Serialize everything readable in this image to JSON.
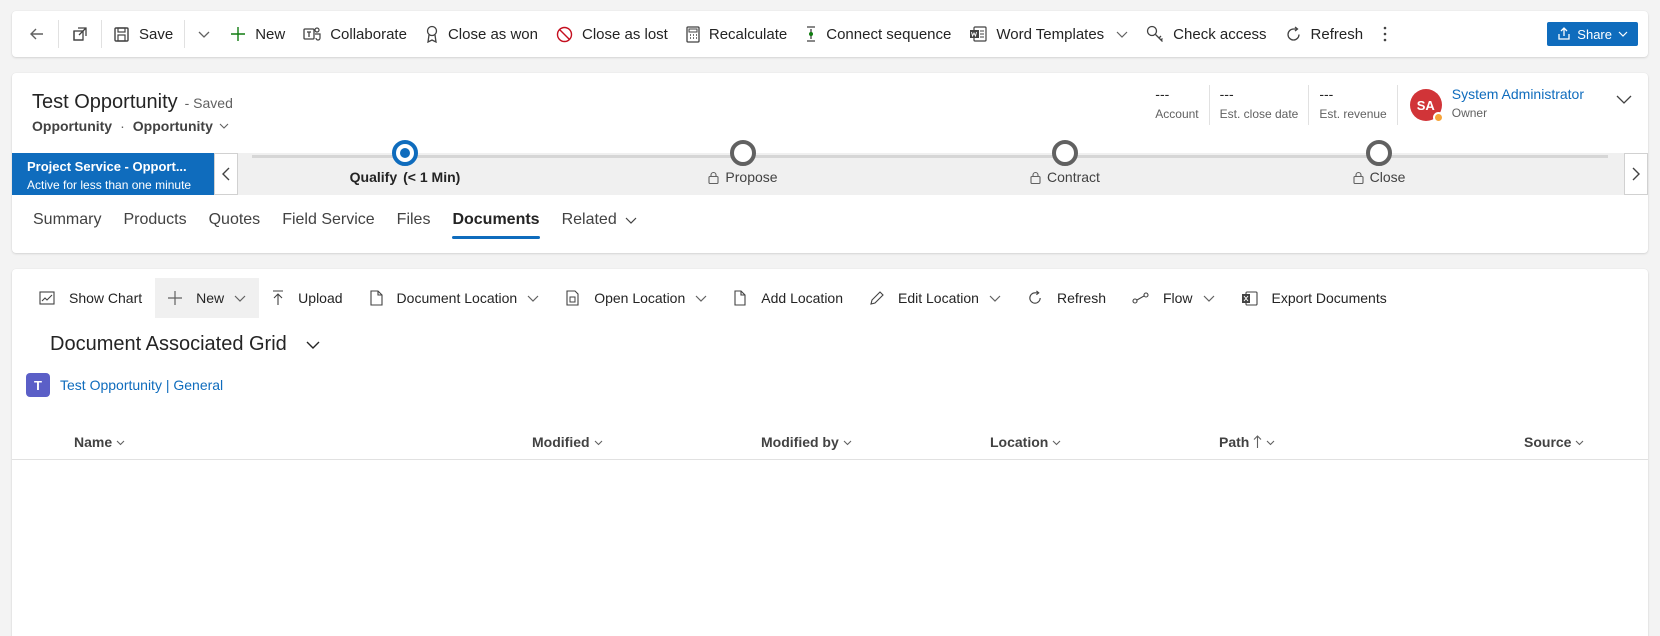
{
  "command_bar": {
    "back": {
      "icon": "back-arrow-icon"
    },
    "popout": {
      "icon": "open-new-window-icon"
    },
    "items": [
      {
        "key": "save",
        "label": "Save",
        "icon": "save-icon"
      },
      {
        "key": "new",
        "label": "New",
        "icon": "plus-icon"
      },
      {
        "key": "collaborate",
        "label": "Collaborate",
        "icon": "teams-icon"
      },
      {
        "key": "close_won",
        "label": "Close as won",
        "icon": "award-icon"
      },
      {
        "key": "close_lost",
        "label": "Close as lost",
        "icon": "prohibited-icon"
      },
      {
        "key": "recalculate",
        "label": "Recalculate",
        "icon": "calculator-icon"
      },
      {
        "key": "connect_sequence",
        "label": "Connect sequence",
        "icon": "sequence-icon"
      },
      {
        "key": "word_templates",
        "label": "Word Templates",
        "icon": "word-icon"
      },
      {
        "key": "check_access",
        "label": "Check access",
        "icon": "key-icon"
      },
      {
        "key": "refresh",
        "label": "Refresh",
        "icon": "refresh-icon"
      }
    ],
    "share_label": "Share"
  },
  "record": {
    "title": "Test Opportunity",
    "status": "- Saved",
    "entity": "Opportunity",
    "separator": "·",
    "form": "Opportunity"
  },
  "header_fields": [
    {
      "value": "---",
      "label": "Account"
    },
    {
      "value": "---",
      "label": "Est. close date"
    },
    {
      "value": "---",
      "label": "Est. revenue"
    }
  ],
  "owner": {
    "initials": "SA",
    "name": "System Administrator",
    "role": "Owner",
    "avatar_color": "#d13438"
  },
  "bpf": {
    "process_name": "Project Service - Opport...",
    "process_status": "Active for less than one minute",
    "stages": [
      {
        "name": "Qualify",
        "duration": "(< 1 Min)",
        "active": true,
        "locked": false
      },
      {
        "name": "Propose",
        "duration": "",
        "active": false,
        "locked": true
      },
      {
        "name": "Contract",
        "duration": "",
        "active": false,
        "locked": true
      },
      {
        "name": "Close",
        "duration": "",
        "active": false,
        "locked": true
      }
    ]
  },
  "tabs": [
    {
      "label": "Summary",
      "active": false
    },
    {
      "label": "Products",
      "active": false
    },
    {
      "label": "Quotes",
      "active": false
    },
    {
      "label": "Field Service",
      "active": false
    },
    {
      "label": "Files",
      "active": false
    },
    {
      "label": "Documents",
      "active": true
    },
    {
      "label": "Related",
      "active": false,
      "dropdown": true
    }
  ],
  "documents": {
    "commands": [
      {
        "key": "show_chart",
        "label": "Show Chart",
        "icon": "chart-icon",
        "dropdown": false
      },
      {
        "key": "new",
        "label": "New",
        "icon": "plus-icon",
        "dropdown": true
      },
      {
        "key": "upload",
        "label": "Upload",
        "icon": "upload-icon",
        "dropdown": false
      },
      {
        "key": "document_location",
        "label": "Document Location",
        "icon": "document-icon",
        "dropdown": true
      },
      {
        "key": "open_location",
        "label": "Open Location",
        "icon": "open-location-icon",
        "dropdown": true
      },
      {
        "key": "add_location",
        "label": "Add Location",
        "icon": "add-document-icon",
        "dropdown": false
      },
      {
        "key": "edit_location",
        "label": "Edit Location",
        "icon": "pencil-icon",
        "dropdown": true
      },
      {
        "key": "refresh",
        "label": "Refresh",
        "icon": "refresh-icon",
        "dropdown": false
      },
      {
        "key": "flow",
        "label": "Flow",
        "icon": "flow-icon",
        "dropdown": true
      },
      {
        "key": "export_documents",
        "label": "Export Documents",
        "icon": "excel-icon",
        "dropdown": false
      }
    ],
    "grid_title": "Document Associated Grid",
    "teams_channel": "Test Opportunity | General",
    "columns": [
      {
        "label": "Name",
        "sorted": false
      },
      {
        "label": "Modified",
        "sorted": false
      },
      {
        "label": "Modified by",
        "sorted": false
      },
      {
        "label": "Location",
        "sorted": false
      },
      {
        "label": "Path",
        "sorted": true
      },
      {
        "label": "Source",
        "sorted": false
      }
    ],
    "rows": []
  },
  "colors": {
    "accent": "#0f6cbd",
    "teams": "#5b5fc7",
    "presence_away": "#f7a43a"
  }
}
